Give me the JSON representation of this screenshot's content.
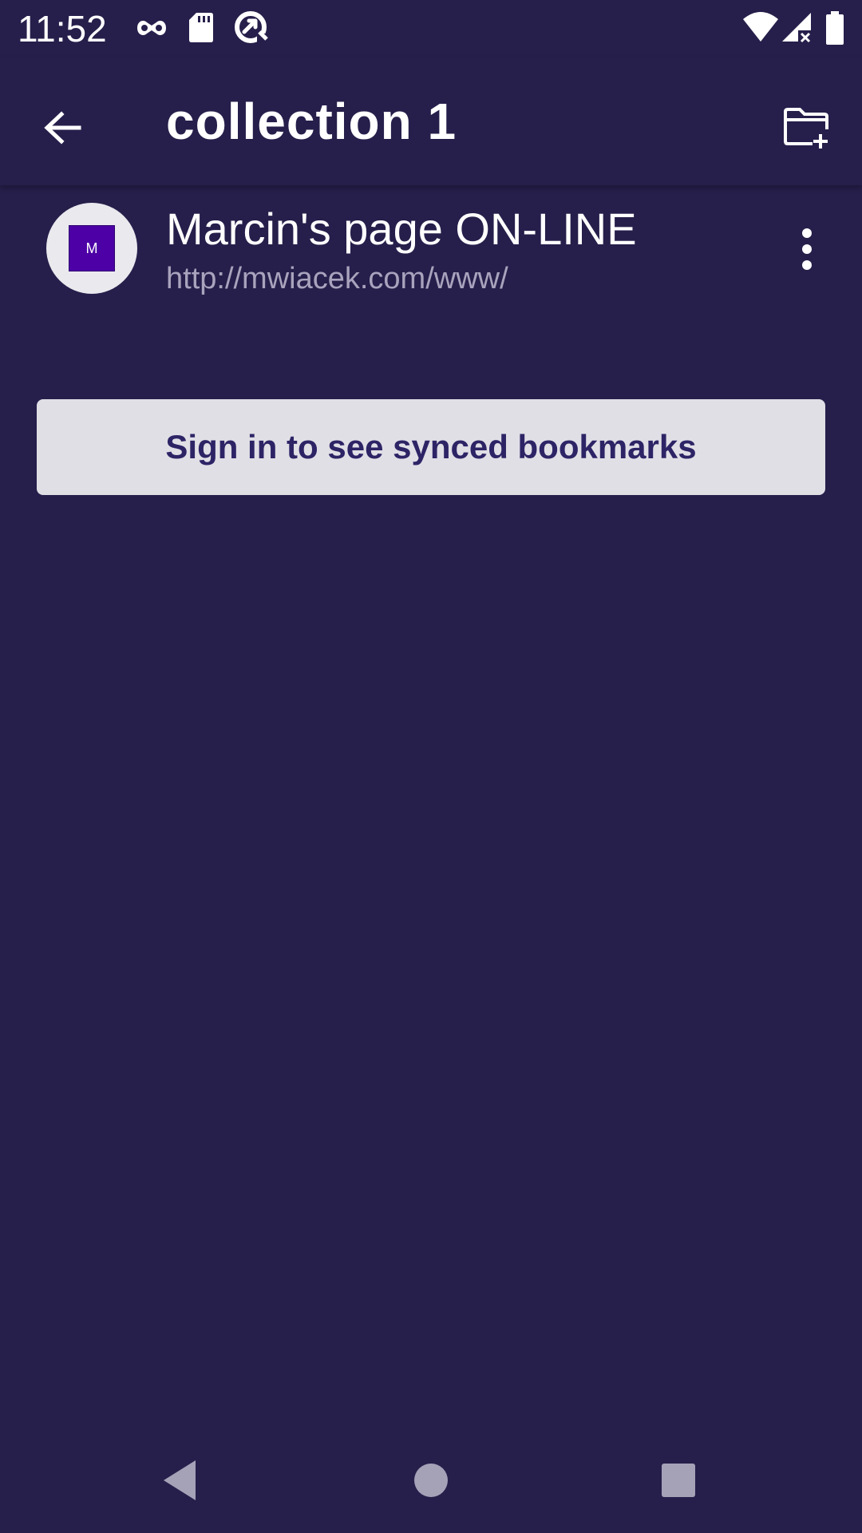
{
  "status_bar": {
    "time": "11:52",
    "icons": [
      "incognito-mask-icon",
      "sd-card-icon",
      "data-saver-icon",
      "wifi-icon",
      "signal-no-data-icon",
      "battery-icon"
    ]
  },
  "app_bar": {
    "title": "collection 1",
    "back_icon": "arrow-back-icon",
    "new_folder_icon": "create-new-folder-icon"
  },
  "bookmarks": [
    {
      "favicon_letter": "M",
      "favicon_color": "#4c00a6",
      "title": "Marcin's page ON-LINE",
      "url": "http://mwiacek.com/www/",
      "menu_icon": "more-vertical-icon"
    }
  ],
  "sign_in": {
    "label": "Sign in to see synced bookmarks"
  },
  "nav_bar": {
    "back_icon": "nav-back-triangle-icon",
    "home_icon": "nav-home-circle-icon",
    "recents_icon": "nav-recents-square-icon"
  },
  "colors": {
    "background": "#261f4b",
    "text_primary": "#ffffff",
    "text_secondary": "#a9a3bd",
    "button_bg": "#e0dfe6",
    "button_text": "#2d2466",
    "nav_icons": "#a5a2b8"
  }
}
